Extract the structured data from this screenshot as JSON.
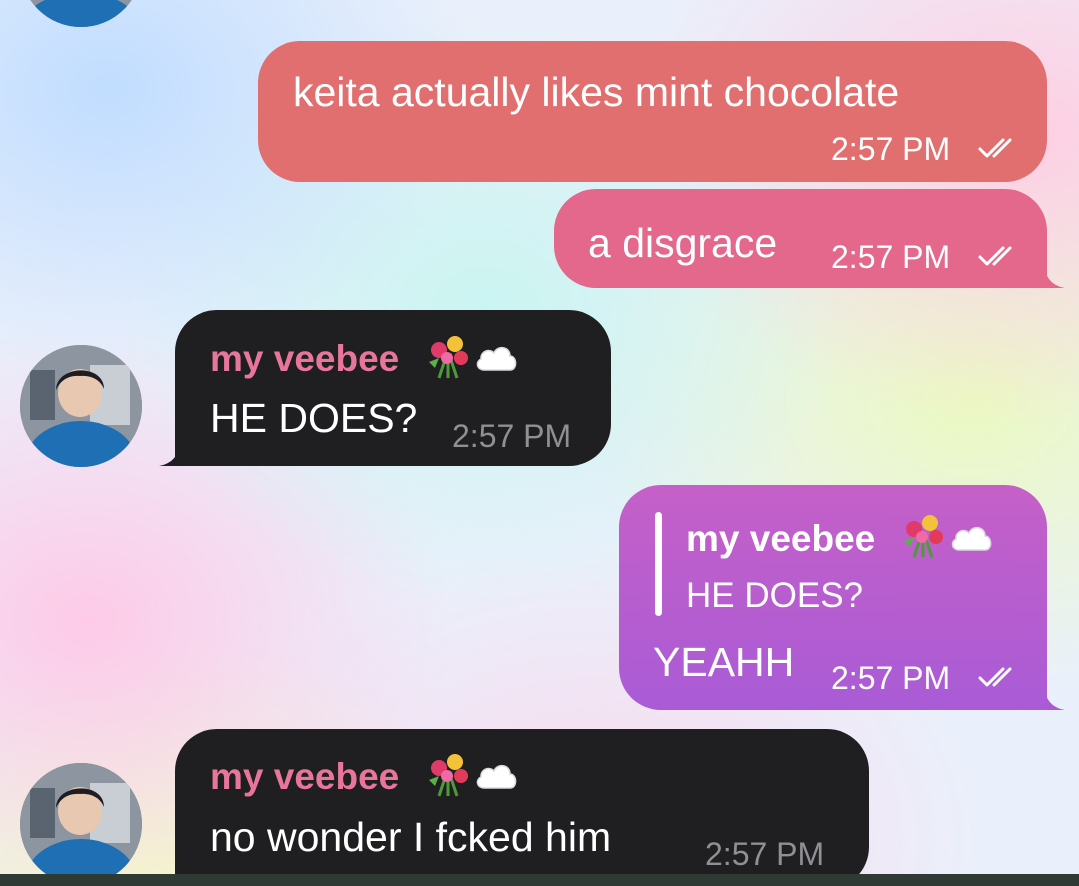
{
  "chat": {
    "messages": [
      {
        "direction": "outgoing",
        "text": "keita actually likes mint chocolate",
        "time": "2:57 PM",
        "status_icon": "double-check-icon"
      },
      {
        "direction": "outgoing",
        "text": "a disgrace",
        "time": "2:57 PM",
        "status_icon": "double-check-icon"
      },
      {
        "direction": "incoming",
        "sender": "my veebee",
        "sender_icons": [
          "bouquet-icon",
          "cloud-icon"
        ],
        "text": "HE DOES?",
        "time": "2:57 PM"
      },
      {
        "direction": "outgoing",
        "reply_to": {
          "sender": "my veebee",
          "sender_icons": [
            "bouquet-icon",
            "cloud-icon"
          ],
          "text": "HE DOES?"
        },
        "text": "YEAHH",
        "time": "2:57 PM",
        "status_icon": "double-check-icon"
      },
      {
        "direction": "incoming",
        "sender": "my veebee",
        "sender_icons": [
          "bouquet-icon",
          "cloud-icon"
        ],
        "text": "no wonder I fcked him",
        "time": "2:57 PM"
      }
    ]
  },
  "colors": {
    "outgoing_1": "#e26f6f",
    "outgoing_2": "#e4678c",
    "outgoing_3": "#b25ed0",
    "incoming": "#1f1f21",
    "sender_name": "#e8769b",
    "incoming_time": "#8f8f94"
  }
}
